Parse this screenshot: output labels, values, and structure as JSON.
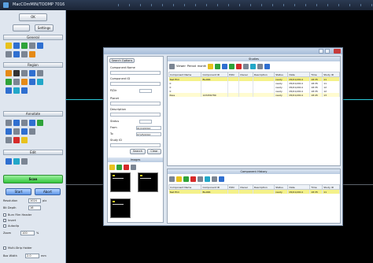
{
  "window": {
    "title": "MacCOmMIN/TOOMP 7016"
  },
  "left_panel": {
    "top_buttons": [
      "OK",
      "",
      "Settings"
    ],
    "sections": {
      "general": "General",
      "region": "Region",
      "annotate": "Annotate",
      "edit": "Edit",
      "scan": "Scan"
    },
    "scan_buttons": {
      "start": "Start",
      "abort": "Abort"
    },
    "settings": [
      {
        "label": "Resolution",
        "value": "1024",
        "unit": "pix"
      },
      {
        "label": "Bit Depth",
        "value": "16"
      },
      {
        "label": "Burn Film Header"
      },
      {
        "label": "Invert"
      },
      {
        "label": "Autoclip"
      },
      {
        "label": "Zoom",
        "value": "100",
        "unit": "%"
      },
      {
        "label": "Multi-Strip Holder"
      },
      {
        "label": "Box Width",
        "value": "2.0",
        "unit": "mm"
      }
    ]
  },
  "dialog": {
    "search": {
      "title": "Search Options",
      "fields": [
        "Component Name",
        "Component ID",
        "P/Dir",
        "Planet",
        "Description",
        "Status",
        "From",
        "To",
        "Study ID"
      ],
      "from_value": "01/10/2012",
      "to_value": "07/25/2012",
      "search_button": "Search",
      "clear_button": "Clear"
    },
    "images": {
      "title": "Images"
    },
    "studies": {
      "title": "Studies",
      "toolbar": {
        "viewer": "Viewer",
        "period": "Period",
        "period_value": "month"
      },
      "columns": [
        "Component Name",
        "Component ID",
        "P/Dir",
        "Owner",
        "Description",
        "Status",
        "Date",
        "Time",
        "Study ID"
      ],
      "rows": [
        {
          "name": "Test film",
          "id": "BLANK",
          "pdir": "",
          "owner": "",
          "desc": "",
          "status": "ready",
          "date": "05/01/2014",
          "time": "18:35",
          "study": "11"
        },
        {
          "name": "0",
          "id": "",
          "pdir": "",
          "owner": "",
          "desc": "",
          "status": "ready",
          "date": "05/01/2014",
          "time": "18:35",
          "study": "11"
        },
        {
          "name": "0",
          "id": "",
          "pdir": "",
          "owner": "",
          "desc": "",
          "status": "ready",
          "date": "05/01/2014",
          "time": "18:35",
          "study": "12"
        },
        {
          "name": "0",
          "id": "",
          "pdir": "",
          "owner": "",
          "desc": "",
          "status": "ready",
          "date": "05/01/2014",
          "time": "18:35",
          "study": "12"
        },
        {
          "name": "Pass",
          "id": "123456789",
          "pdir": "",
          "owner": "",
          "desc": "",
          "status": "ready",
          "date": "05/01/2014",
          "time": "18:45",
          "study": "13"
        }
      ]
    },
    "components": {
      "title": "Component History",
      "columns": [
        "Component Name",
        "Component ID",
        "P/Dir",
        "Owner",
        "Description",
        "Status",
        "Date",
        "Time",
        "Study ID"
      ],
      "rows": [
        {
          "name": "Test film",
          "id": "BLANK",
          "pdir": "",
          "owner": "",
          "desc": "",
          "status": "ready",
          "date": "05/01/2014",
          "time": "18:35",
          "study": "11"
        }
      ]
    }
  }
}
